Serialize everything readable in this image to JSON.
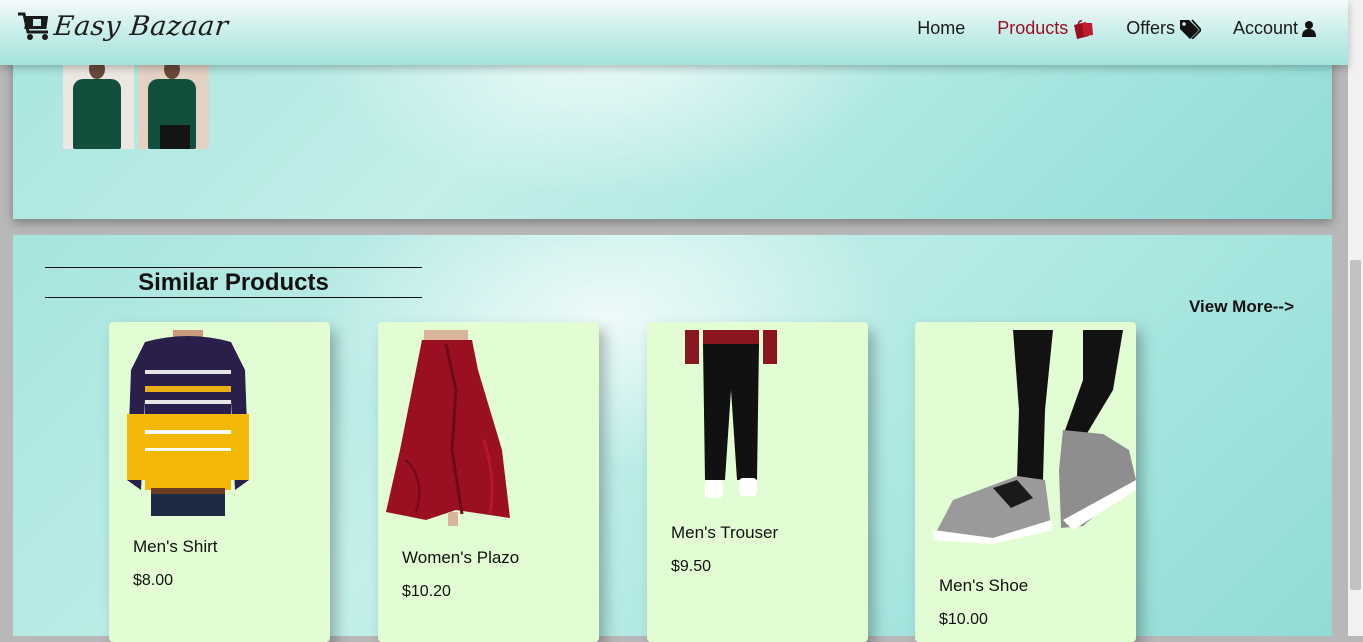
{
  "brand": {
    "name": "Easy Bazaar",
    "icon": "shopping-cart-icon"
  },
  "nav": [
    {
      "label": "Home",
      "icon": ""
    },
    {
      "label": "Products",
      "icon": "shopping-bags-icon"
    },
    {
      "label": "Offers",
      "icon": "tags-icon"
    },
    {
      "label": "Account",
      "icon": "user-icon"
    }
  ],
  "nav_active_color": "#9b0e22",
  "similar": {
    "title": "Similar Products",
    "view_more": "View More-->",
    "products": [
      {
        "name": "Men's Shirt",
        "price": "$8.00",
        "image": "striped-sweater-image"
      },
      {
        "name": "Women's Plazo",
        "price": "$10.20",
        "image": "red-skirt-image"
      },
      {
        "name": "Men's Trouser",
        "price": "$9.50",
        "image": "black-trouser-image"
      },
      {
        "name": "Men's Shoe",
        "price": "$10.00",
        "image": "grey-sneaker-image"
      }
    ]
  },
  "colors": {
    "card_bg": "#e2fdd3",
    "panel_teal": "#a7e4de"
  }
}
